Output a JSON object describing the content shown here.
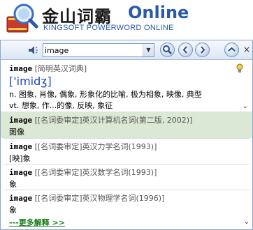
{
  "brand": {
    "name_cn": "金山词霸",
    "name_online": "Online",
    "subtitle": "KINGSOFT POWERWORD ONLINE"
  },
  "toolbar": {
    "search_value": "image",
    "dropdown_icon": "chevron-down-icon",
    "close_label": "×"
  },
  "entries": [
    {
      "word": "image",
      "source": "[简明英汉词典]",
      "phonetic": "['imidʒ]",
      "line1": "n. 图象, 肖像, 偶象, 形象化的比喻, 极为相象, 映像, 典型",
      "line2": "vt. 想象, 作...的像, 反映, 象征"
    },
    {
      "word": "image",
      "source": "[[名词委审定]英汉计算机名词(第二版, 2002)]",
      "line1": "图像"
    },
    {
      "word": "image",
      "source": "[[名词委审定]英汉力学名词(1993)]",
      "line1": "[映]象"
    },
    {
      "word": "image",
      "source": "[[名词委审定]英汉数学名词(1993)]",
      "line1": "象"
    },
    {
      "word": "image",
      "source": "[[名词委审定]英汉物理学名词(1996)]",
      "line1": "象"
    }
  ],
  "more_link": "---更多解释 >>",
  "colors": {
    "highlight": "#dbe8d3",
    "phonetic": "#1a44c8",
    "brand_blue": "#2a5aa8",
    "more_link": "#1a7a1a"
  }
}
